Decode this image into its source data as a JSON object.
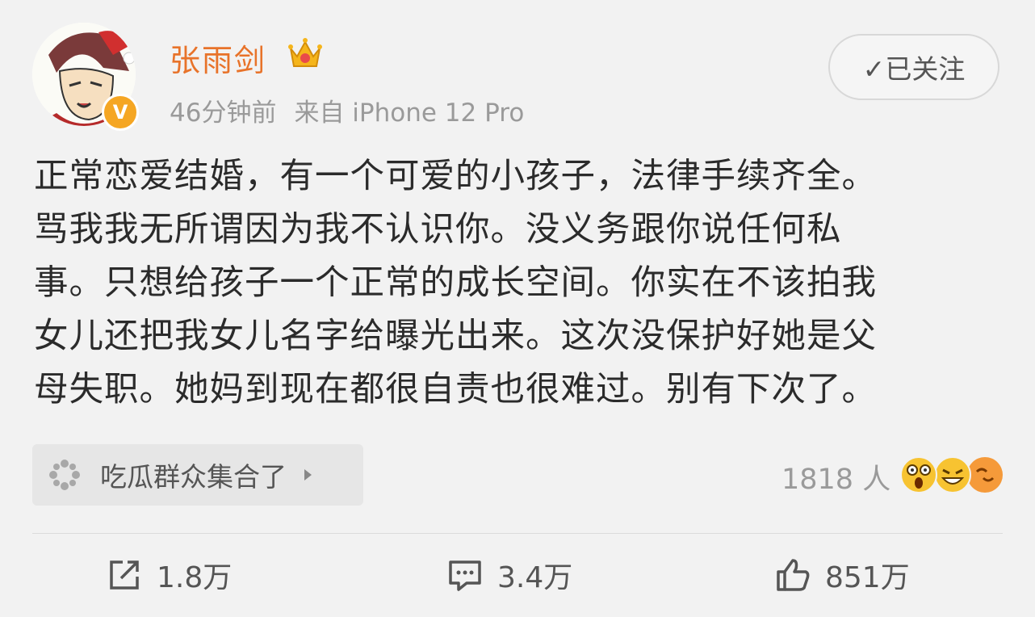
{
  "post": {
    "username": "张雨剑",
    "time_ago": "46分钟前",
    "source": "来自 iPhone 12 Pro",
    "follow_label": "✓已关注",
    "content_lines": [
      "正常恋爱结婚，有一个可爱的小孩子，法律手续齐全。",
      "骂我我无所谓因为我不认识你。没义务跟你说任何私",
      "事。只想给孩子一个正常的成长空间。你实在不该拍我",
      "女儿还把我女儿名字给曝光出来。这次没保护好她是父",
      "母失职。她妈到现在都很自责也很难过。别有下次了。"
    ]
  },
  "topic": {
    "label": "吃瓜群众集合了"
  },
  "reactions": {
    "count_text": "1818 人"
  },
  "actions": {
    "repost": "1.8万",
    "comment": "3.4万",
    "like": "851万"
  },
  "colors": {
    "username": "#e8732a",
    "verified_badge": "#f5a623",
    "background": "#f2f2f2"
  },
  "icons": [
    "avatar-cartoon",
    "verified-badge-icon",
    "crown-icon",
    "topic-icon",
    "share-icon",
    "comment-icon",
    "like-icon"
  ]
}
